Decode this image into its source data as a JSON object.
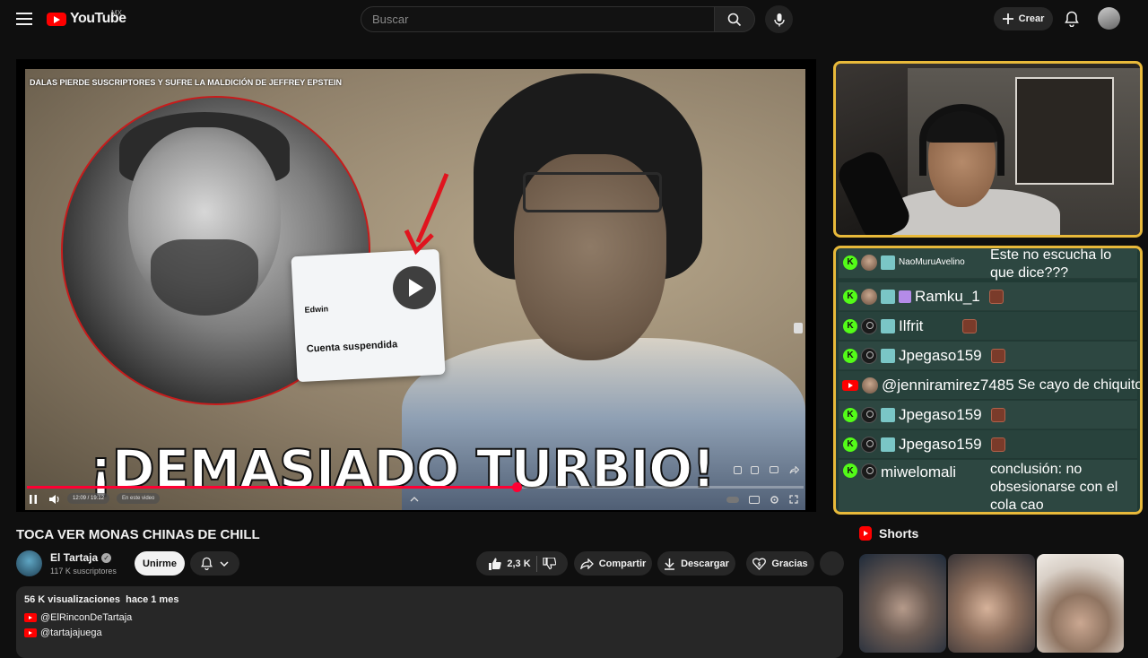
{
  "header": {
    "logo_text": "YouTube",
    "region": "MX",
    "search_placeholder": "Buscar",
    "create_label": "Crear"
  },
  "player": {
    "video_title_overlay": "DALAS PIERDE SUSCRIPTORES Y SUFRE LA MALDICIÓN DE JEFFREY EPSTEIN",
    "headline": "¡DEMASIADO TURBIO!",
    "tweet_name": "Edwin",
    "tweet_status": "Cuenta suspendida",
    "time_display": "12:09 / 19:12",
    "chapter_label": "En este video",
    "progress": 0.63
  },
  "chat": {
    "messages": [
      {
        "platform": "kick",
        "user": "NaoMuruAvelino",
        "text": "Este no escucha lo que dice???"
      },
      {
        "platform": "kick",
        "user": "Ramku_1",
        "text": ""
      },
      {
        "platform": "kick",
        "user": "Ilfrit",
        "text": ""
      },
      {
        "platform": "kick",
        "user": "Jpegaso159",
        "text": ""
      },
      {
        "platform": "youtube",
        "user": "@jenniramirez7485",
        "text": "Se cayo de chiquito"
      },
      {
        "platform": "kick",
        "user": "Jpegaso159",
        "text": ""
      },
      {
        "platform": "kick",
        "user": "Jpegaso159",
        "text": ""
      },
      {
        "platform": "kick",
        "user": "miwelomali",
        "text_lines": [
          "conclusión: no",
          "obsesionarse con el",
          "cola cao"
        ]
      }
    ]
  },
  "video": {
    "title": "TOCA VER MONAS CHINAS DE CHILL",
    "channel_name": "El Tartaja",
    "subscribers": "117 K suscriptores",
    "join_label": "Unirme",
    "likes": "2,3 K",
    "share_label": "Compartir",
    "download_label": "Descargar",
    "thanks_label": "Gracias"
  },
  "description": {
    "views": "56 K visualizaciones",
    "date": "hace 1 mes",
    "links": [
      "@ElRinconDeTartaja",
      "@tartajajuega"
    ]
  },
  "shorts": {
    "heading": "Shorts"
  }
}
